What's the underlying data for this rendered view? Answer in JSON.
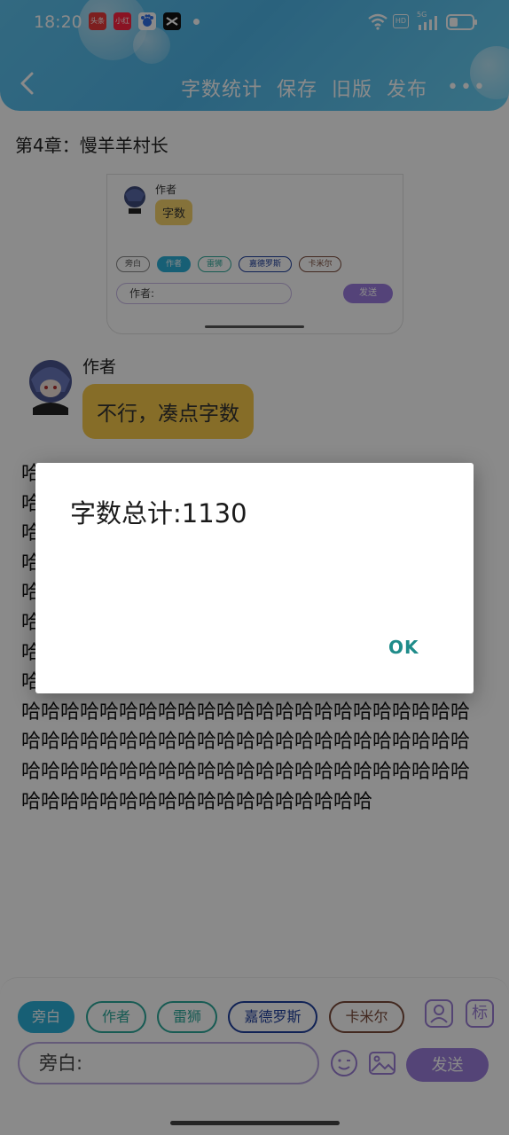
{
  "status_bar": {
    "time": "18:20",
    "app_icons": [
      {
        "name": "toutiao-icon",
        "label": "头条",
        "color": "#e83a3a"
      },
      {
        "name": "xiaohongshu-icon",
        "label": "小红书",
        "color": "#ff2442"
      },
      {
        "name": "baidu-icon",
        "label": "",
        "color": "#2f6fe8"
      },
      {
        "name": "capcut-icon",
        "label": "",
        "color": "#111111"
      }
    ],
    "network": "5G",
    "hd": "HD"
  },
  "toolbar": {
    "word_count_label": "字数统计",
    "save_label": "保存",
    "old_version_label": "旧版",
    "publish_label": "发布",
    "more_label": "•••"
  },
  "chapter_title": "第4章：慢羊羊村长",
  "embedded_screenshot": {
    "speaker": "作者",
    "bubble_text": "字数",
    "tags": [
      "旁白",
      "作者",
      "雷狮",
      "嘉德罗斯",
      "卡米尔"
    ],
    "input_text": "作者:",
    "send_label": "发送"
  },
  "message": {
    "speaker": "作者",
    "text": "不行，凑点字数"
  },
  "long_text": "哈哈哈哈哈哈哈哈哈哈哈哈哈哈哈哈哈哈哈哈哈好哈哈哈哈哈哈哈哈哈哈哈哈哈哈哈哈哈哈哈哈哈哈哈哈哈哈哈哈哈哈哈哈哈哈哈哈哈哈哈哈哈哈哈哈哈哈哈哈哈哈哈哈哈哈哈哈哈哈哈哈哈哈哈哈哈哈哈哈哈哈哈哈哈哈哈哈哈哈哈哈哈哈哈哈哈哈哈哈哈哈哈哈哈哈哈哈哈哈哈哈哈哈哈哈哈哈哈哈哈哈哈哈哈哈哈哈哈哈哈哈哈哈哈哈哈哈哈哈哈哈哈哈哈哈哈哈哈哈哈哈哈哈哈哈哈哈哈哈哈哈哈哈哈哈哈哈哈哈哈哈哈哈哈哈哈哈哈哈哈哈哈哈哈哈哈哈哈哈哈哈哈哈哈哈哈哈哈哈哈哈哈哈哈哈哈哈哈哈哈哈哈哈哈哈哈哈哈哈哈哈哈哈哈哈哈哈哈哈哈哈哈哈哈哈哈哈哈哈哈哈哈哈哈哈哈哈哈哈哈哈哈哈哈哈哈哈哈哈哈",
  "bottom_bar": {
    "tags": [
      {
        "label": "旁白",
        "color": "#2bb0d8",
        "active": true
      },
      {
        "label": "作者",
        "color": "#2ba89a",
        "active": false
      },
      {
        "label": "雷狮",
        "color": "#2ba89a",
        "active": false
      },
      {
        "label": "嘉德罗斯",
        "color": "#1f3f9e",
        "active": false
      },
      {
        "label": "卡米尔",
        "color": "#7a4a3a",
        "active": false
      }
    ],
    "role_icon": "person-icon",
    "tag_icon_label": "标",
    "input_text": "旁白:",
    "send_label": "发送"
  },
  "dialog": {
    "title": "字数总计:1130",
    "ok_label": "OK"
  },
  "colors": {
    "header": "#4fb6e8",
    "accent_purple": "#9b7fdc",
    "bubble_yellow": "#f7c94a",
    "ok_teal": "#1f8c8a"
  }
}
